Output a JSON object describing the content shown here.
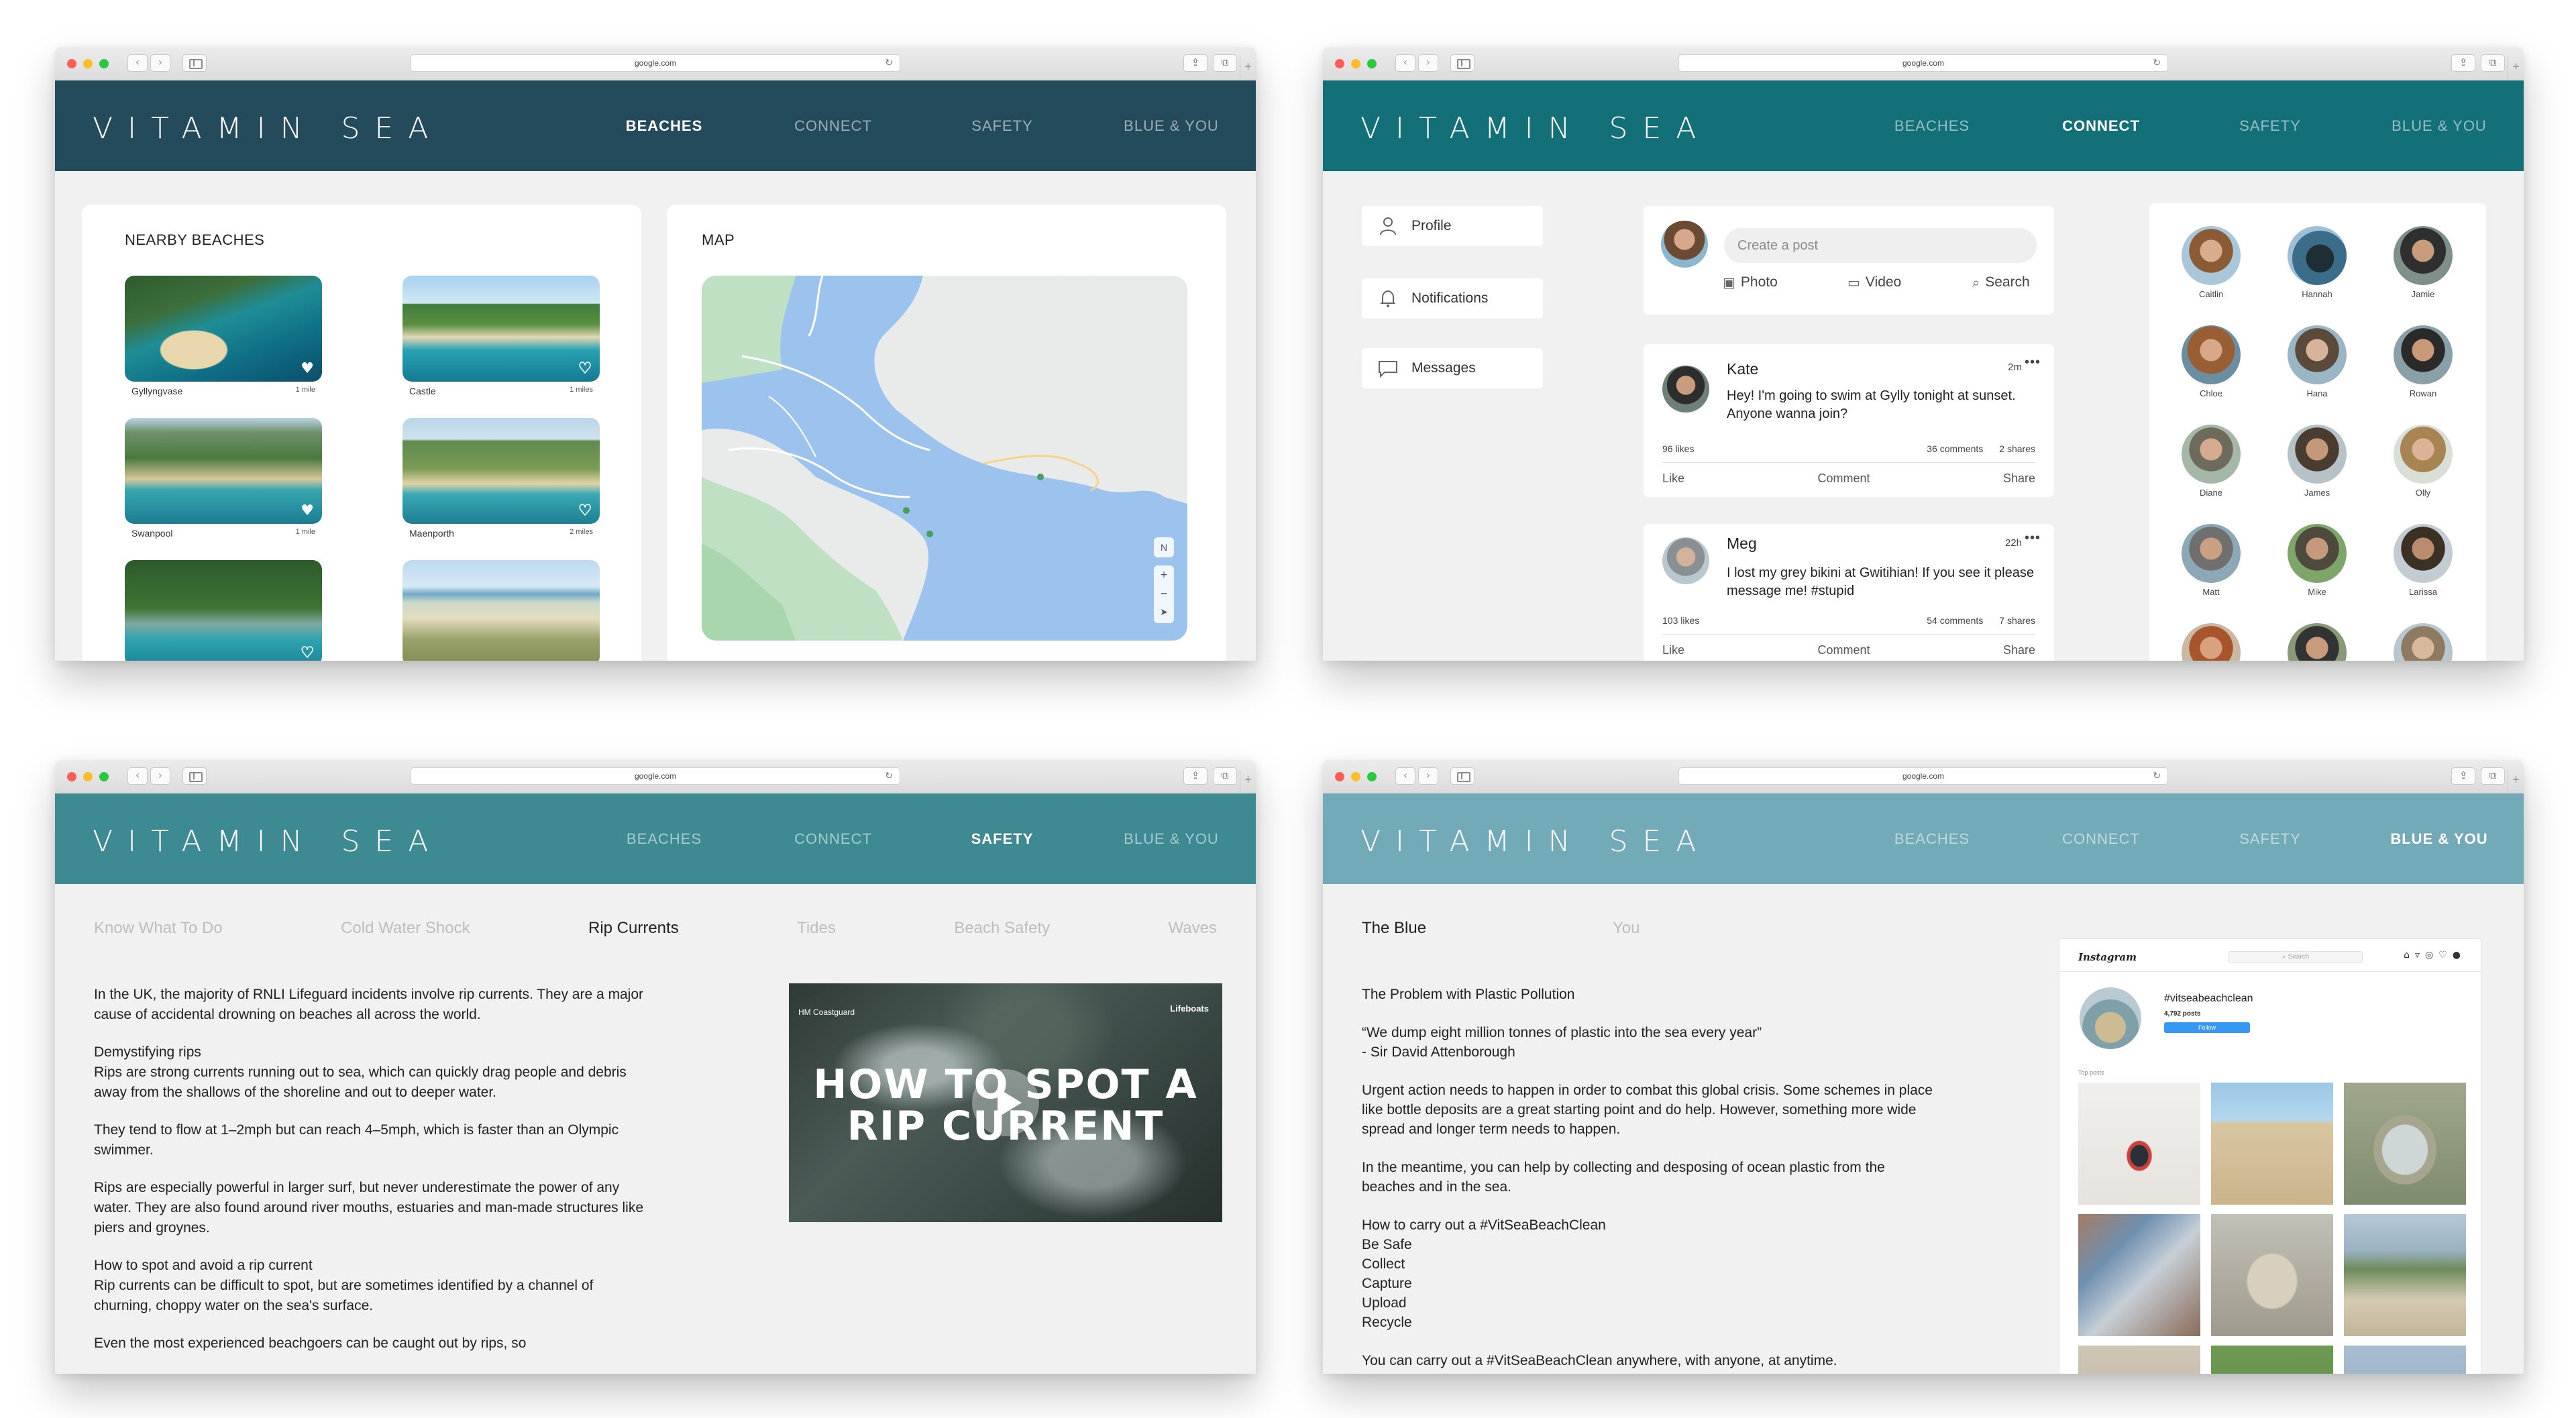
{
  "browser": {
    "url": "google.com"
  },
  "site": {
    "logo": "VITAMIN SEA",
    "nav": [
      "BEACHES",
      "CONNECT",
      "SAFETY",
      "BLUE & YOU"
    ]
  },
  "beaches_screen": {
    "nearby_title": "NEARBY BEACHES",
    "map_title": "MAP",
    "beaches": [
      {
        "name": "Gyllyngvase",
        "distance": "1 mile",
        "favorited": true
      },
      {
        "name": "Castle",
        "distance": "1 miles",
        "favorited": false
      },
      {
        "name": "Swanpool",
        "distance": "1 mile",
        "favorited": true
      },
      {
        "name": "Maenporth",
        "distance": "2 miles",
        "favorited": false
      },
      {
        "name": "",
        "distance": "",
        "favorited": false
      },
      {
        "name": "",
        "distance": "",
        "favorited": false
      }
    ],
    "compass": "N"
  },
  "connect_screen": {
    "side_nav": [
      "Profile",
      "Notifications",
      "Messages"
    ],
    "create_placeholder": "Create a post",
    "create_actions": [
      "Photo",
      "Video",
      "Search"
    ],
    "posts": [
      {
        "author": "Kate",
        "time": "2m",
        "text": "Hey! I'm going to swim at Gylly tonight at sunset. Anyone wanna join?",
        "likes": "96 likes",
        "comments": "36 comments",
        "shares": "2 shares"
      },
      {
        "author": "Meg",
        "time": "22h",
        "text": "I lost my grey bikini at Gwitihian! If you see it please message me! #stupid",
        "likes": "103 likes",
        "comments": "54 comments",
        "shares": "7 shares"
      }
    ],
    "post_actions": [
      "Like",
      "Comment",
      "Share"
    ],
    "friends": [
      "Caitlin",
      "Hannah",
      "Jamie",
      "Chloe",
      "Hana",
      "Rowan",
      "Diane",
      "James",
      "Olly",
      "Matt",
      "Mike",
      "Larissa",
      "",
      "",
      ""
    ]
  },
  "safety_screen": {
    "tabs": [
      "Know What To Do",
      "Cold Water Shock",
      "Rip Currents",
      "Tides",
      "Beach Safety",
      "Waves"
    ],
    "active_tab": "Rip Currents",
    "paragraphs": [
      "In the UK, the majority of RNLI Lifeguard incidents involve rip currents. They are a major cause of accidental drowning on beaches all across the world.",
      "Demystifying rips\nRips are strong currents running out to sea, which can quickly drag people and debris away from the shallows of the shoreline and out to deeper water.",
      "They tend to flow at 1–2mph but can reach 4–5mph, which is faster than an Olympic swimmer.",
      "Rips are especially powerful in larger surf, but never underestimate the power of any water. They are also found around river mouths, estuaries and man-made structures like piers and groynes.",
      "How to spot and avoid a rip current\nRip currents can be difficult to spot, but are sometimes identified by a channel of churning, choppy water on the sea's surface.",
      "Even the most experienced beachgoers can be caught out by rips, so"
    ],
    "video_title": "HOW TO SPOT A RIP CURRENT",
    "video_brand_left": "HM Coastguard",
    "video_brand_right": "Lifeboats"
  },
  "blue_screen": {
    "tabs": [
      "The Blue",
      "You"
    ],
    "active_tab": "The Blue",
    "paragraphs": [
      "The Problem with Plastic Pollution",
      "“We dump eight million tonnes of plastic into the sea every year”\n- Sir David Attenborough",
      "Urgent action needs to happen in order to combat this global crisis. Some schemes in place like bottle deposits are a great starting point and do help. However, something more wide spread and longer term needs to happen.",
      "In the meantime, you can help by collecting and desposing of ocean plastic from the beaches and in the sea.",
      "How to carry out a #VitSeaBeachClean\nBe Safe\nCollect\nCapture\nUpload\nRecycle",
      "You can carry out a #VitSeaBeachClean anywhere, with anyone, at anytime."
    ],
    "instagram": {
      "logo": "Instagram",
      "search": "Search",
      "hashtag": "#vitseabeachclean",
      "posts_count": "4,792 posts",
      "follow": "Follow",
      "top_posts": "Top posts"
    }
  },
  "colors": {
    "header_beaches": "#244b5b",
    "header_connect": "#137079",
    "header_safety": "#3d8a93",
    "header_blue": "#72aab7"
  }
}
